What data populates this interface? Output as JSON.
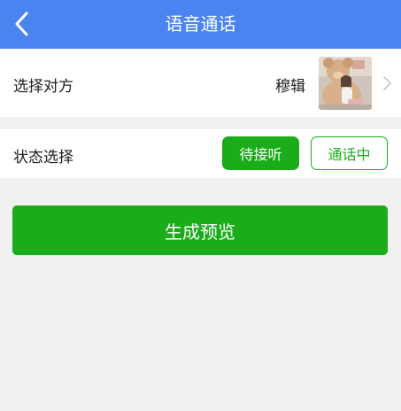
{
  "header": {
    "title": "语音通话",
    "back_icon": "chevron-left-icon",
    "background": "#4a84f0"
  },
  "contact_row": {
    "label": "选择对方",
    "name": "穆辑",
    "avatar": "teddy-bear-photo-avatar",
    "arrow_icon": "chevron-right-icon"
  },
  "status_row": {
    "label": "状态选择",
    "options": [
      {
        "label": "待接听",
        "selected": true
      },
      {
        "label": "通话中",
        "selected": false
      }
    ]
  },
  "generate_button": {
    "label": "生成预览"
  },
  "colors": {
    "accent_green": "#1aad19",
    "page_background": "#f1f1f1"
  }
}
